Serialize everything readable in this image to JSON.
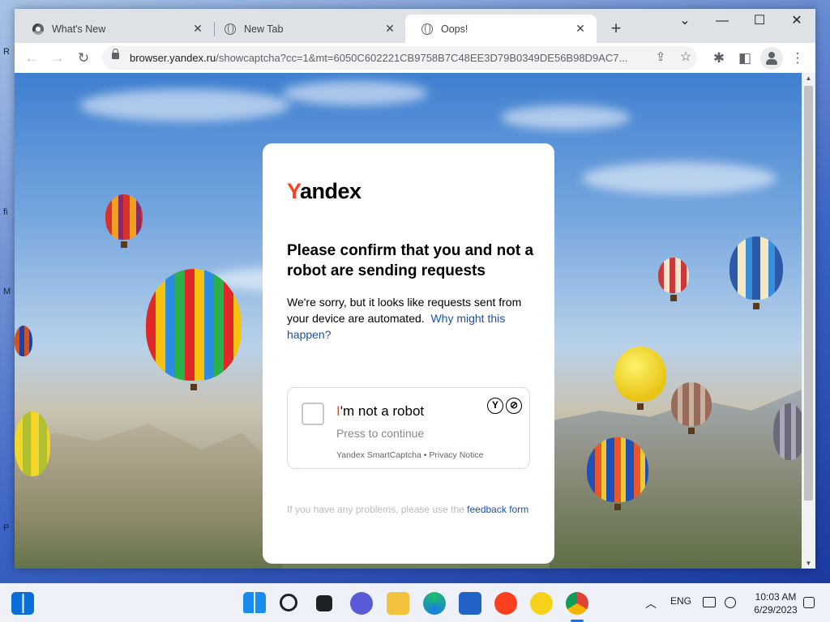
{
  "browser": {
    "tabs": [
      {
        "label": "What's New",
        "close": "✕",
        "icon": "chrome-icon"
      },
      {
        "label": "New Tab",
        "close": "✕",
        "icon": "globe-icon"
      },
      {
        "label": "Oops!",
        "close": "✕",
        "icon": "globe-icon",
        "active": true
      }
    ],
    "new_tab": "+",
    "window_controls": {
      "dropdown": "⌄",
      "minimize": "—",
      "maximize": "☐",
      "close": "✕"
    },
    "toolbar": {
      "back": "←",
      "forward": "→",
      "reload": "↻",
      "share": "⇪",
      "bookmark": "☆",
      "extensions": "✱",
      "sidebar": "◧",
      "menu": "⋮"
    },
    "address": {
      "host": "browser.yandex.ru",
      "path": "/showcaptcha?cc=1&mt=6050C602221CB9758B7C48EE3D79B0349DE56B98D9AC7..."
    }
  },
  "captcha": {
    "logo_first": "Y",
    "logo_rest": "andex",
    "heading": "Please confirm that you and not a robot are sending requests",
    "body": "We're sorry, but it looks like requests sent from your device are automated.",
    "why_link": "Why might this happen?",
    "checkbox_title_first": "I",
    "checkbox_title_rest": "'m not a robot",
    "checkbox_sub": "Press to continue",
    "checkbox_footer": "Yandex SmartCaptcha • Privacy Notice",
    "feedback_text": "If you have any problems, please use the",
    "feedback_link": "feedback form"
  },
  "taskbar": {
    "lang": "ENG",
    "time": "10:03 AM",
    "date": "6/29/2023",
    "tray_chevron": "︿"
  },
  "desktop_glyphs": [
    "R",
    "fi",
    "M",
    "P"
  ]
}
